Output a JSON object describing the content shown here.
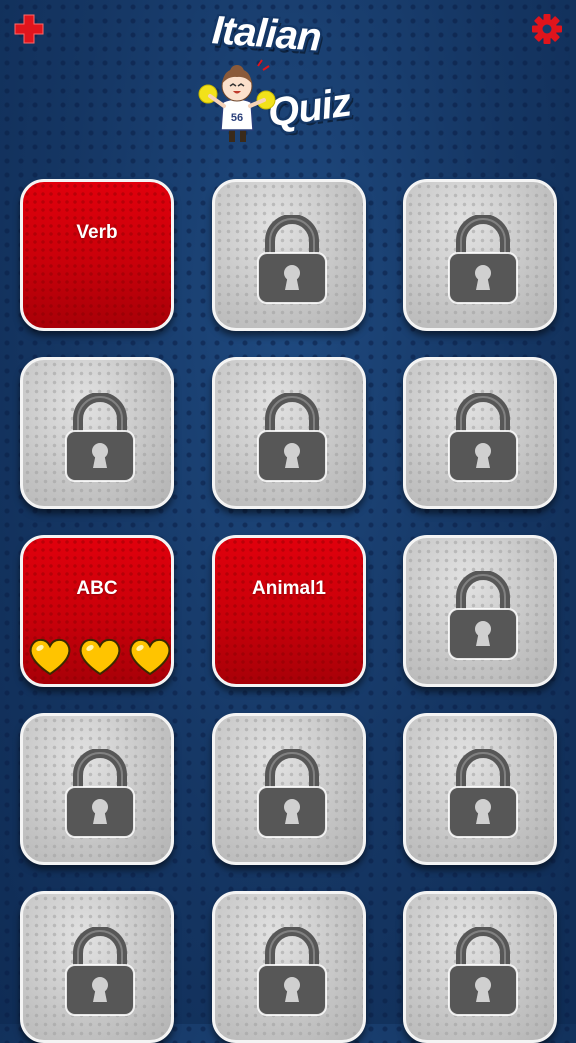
{
  "app": {
    "title_line1": "Italian",
    "title_line2": "Quiz",
    "mascot_jersey_number": "56"
  },
  "header": {
    "add_icon": "plus-icon",
    "settings_icon": "gear-icon"
  },
  "colors": {
    "background": "#163c6c",
    "unlocked_tile": "#c8000a",
    "locked_tile": "#c9c9c9",
    "lock": "#555555",
    "heart": "#ffc400",
    "header_icon": "#e0141c"
  },
  "levels": [
    {
      "label": "Verb",
      "locked": false,
      "hearts": 0
    },
    {
      "label": "",
      "locked": true,
      "hearts": 0
    },
    {
      "label": "",
      "locked": true,
      "hearts": 0
    },
    {
      "label": "",
      "locked": true,
      "hearts": 0
    },
    {
      "label": "",
      "locked": true,
      "hearts": 0
    },
    {
      "label": "",
      "locked": true,
      "hearts": 0
    },
    {
      "label": "ABC",
      "locked": false,
      "hearts": 3
    },
    {
      "label": "Animal1",
      "locked": false,
      "hearts": 0
    },
    {
      "label": "",
      "locked": true,
      "hearts": 0
    },
    {
      "label": "",
      "locked": true,
      "hearts": 0
    },
    {
      "label": "",
      "locked": true,
      "hearts": 0
    },
    {
      "label": "",
      "locked": true,
      "hearts": 0
    },
    {
      "label": "",
      "locked": true,
      "hearts": 0
    },
    {
      "label": "",
      "locked": true,
      "hearts": 0
    },
    {
      "label": "",
      "locked": true,
      "hearts": 0
    }
  ]
}
